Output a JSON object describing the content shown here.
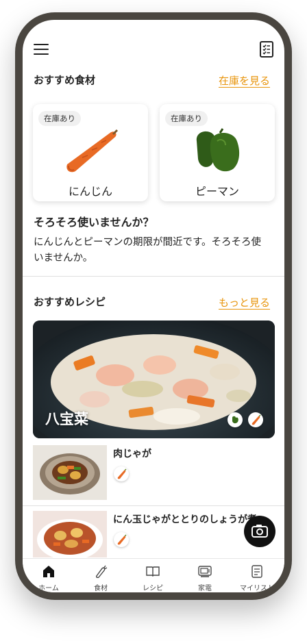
{
  "header": {
    "menu_icon": "hamburger-menu-icon",
    "checklist_icon": "checklist-icon"
  },
  "ingredients": {
    "title": "おすすめ食材",
    "link": "在庫を見る",
    "items": [
      {
        "badge": "在庫あり",
        "name": "にんじん",
        "icon": "carrot-image"
      },
      {
        "badge": "在庫あり",
        "name": "ピーマン",
        "icon": "green-pepper-image"
      }
    ]
  },
  "notice": {
    "title": "そろそろ使いませんか？",
    "body": "にんじんとピーマンの期限が間近です。そろそろ使いませんか。"
  },
  "recipes": {
    "title": "おすすめレシピ",
    "link": "もっと見る",
    "featured": {
      "name": "八宝菜",
      "ingredient_icons": [
        "green-pepper-icon",
        "carrot-icon"
      ]
    },
    "list": [
      {
        "name": "肉じゃが",
        "ingredient_icons": [
          "carrot-icon"
        ]
      },
      {
        "name": "にん玉じゃがととりのしょうが煮",
        "ingredient_icons": [
          "carrot-icon"
        ]
      }
    ]
  },
  "fab": {
    "icon": "camera-icon"
  },
  "bottom_nav": [
    {
      "label": "ホーム",
      "icon": "home-icon",
      "active": true
    },
    {
      "label": "食材",
      "icon": "carrot-icon",
      "active": false
    },
    {
      "label": "レシピ",
      "icon": "book-icon",
      "active": false
    },
    {
      "label": "家電",
      "icon": "microwave-icon",
      "active": false
    },
    {
      "label": "マイリスト",
      "icon": "list-icon",
      "active": false
    }
  ],
  "colors": {
    "accent": "#e8940b",
    "frame": "#4a4640",
    "text": "#222222"
  }
}
